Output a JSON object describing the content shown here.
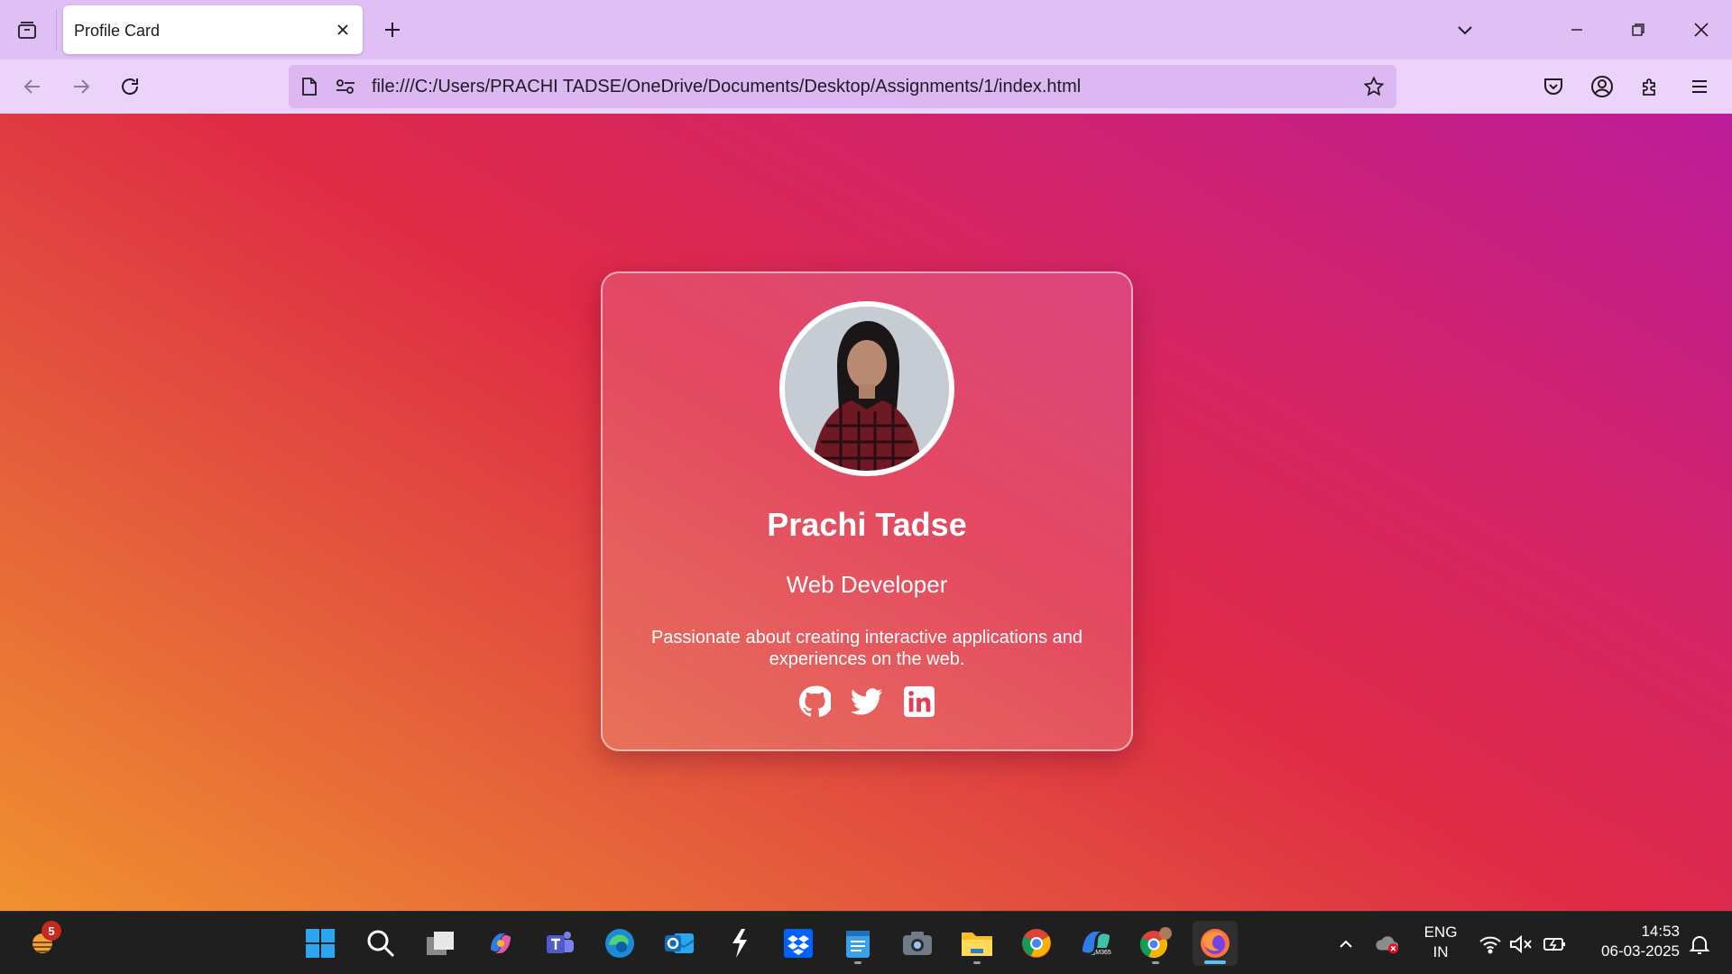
{
  "browser": {
    "tab_title": "Profile Card",
    "url": "file:///C:/Users/PRACHI TADSE/OneDrive/Documents/Desktop/Assignments/1/index.html"
  },
  "profile": {
    "name": "Prachi Tadse",
    "role": "Web Developer",
    "bio": "Passionate about creating interactive applications and experiences on the web.",
    "social_icons": [
      "github-icon",
      "twitter-icon",
      "linkedin-icon"
    ]
  },
  "taskbar": {
    "widget_badge": "5",
    "apps": [
      "start",
      "search",
      "task-view",
      "copilot",
      "teams",
      "edge",
      "outlook",
      "app-s",
      "dropbox",
      "notepad",
      "camera",
      "file-explorer",
      "chrome",
      "microsoft-365",
      "chrome-profile",
      "firefox"
    ],
    "active_app": "firefox"
  },
  "tray": {
    "lang_line1": "ENG",
    "lang_line2": "IN",
    "time": "14:53",
    "date": "06-03-2025"
  },
  "colors": {
    "tab_strip": "#e0bff5",
    "nav_bar": "#ecd3fa",
    "gradient": [
      "#f0912f",
      "#df2a46",
      "#bc1c9a"
    ],
    "taskbar": "#1f1f1f"
  }
}
